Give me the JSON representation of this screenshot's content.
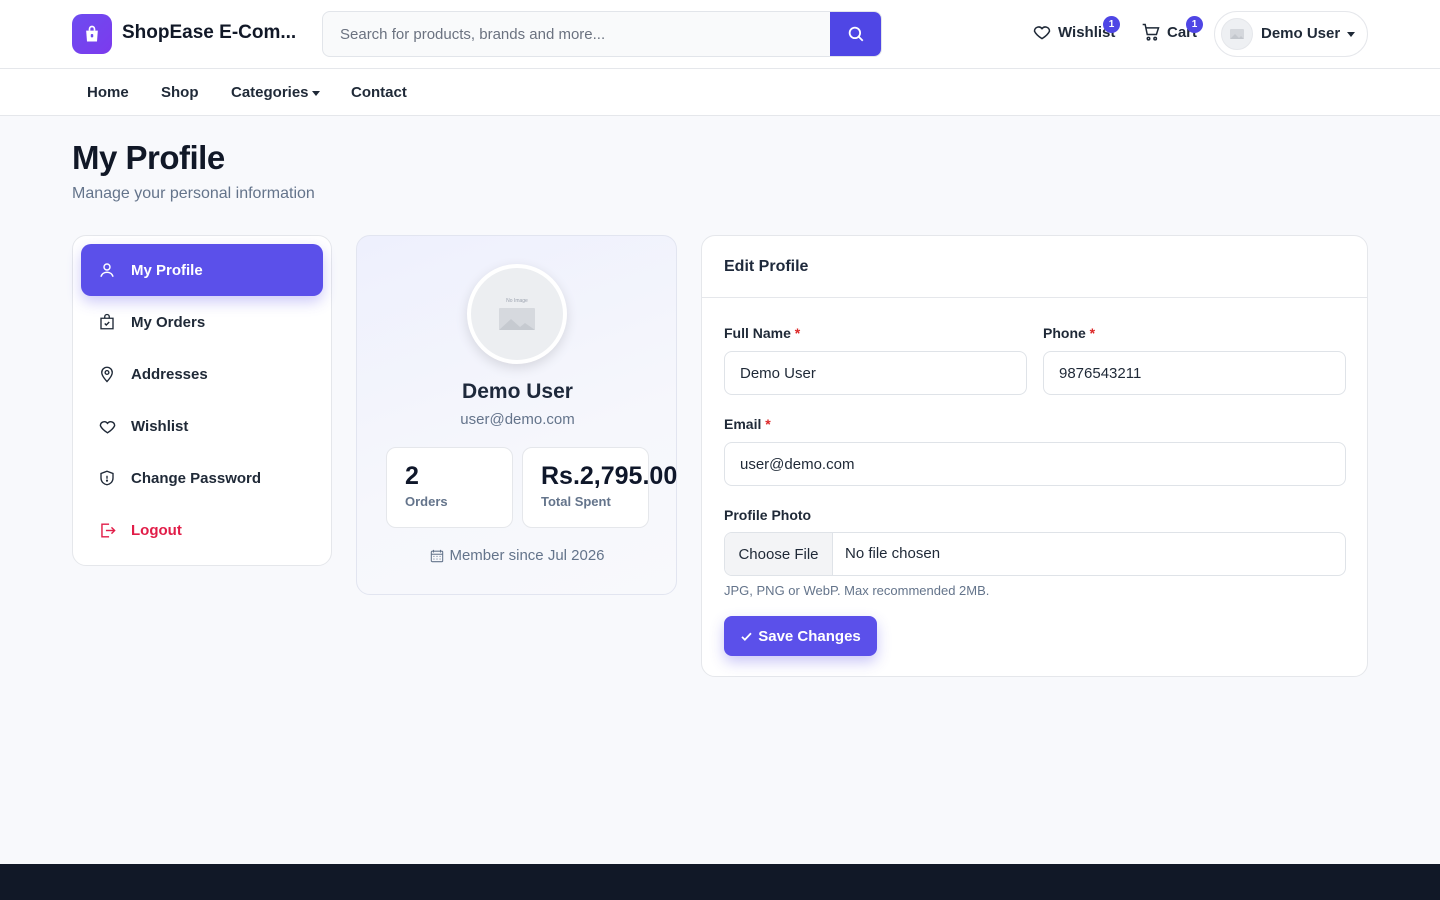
{
  "header": {
    "brand": "ShopEase E-Com...",
    "logo_icon": "shopping-bag-icon",
    "search_placeholder": "Search for products, brands and more...",
    "wishlist_label": "Wishlist",
    "wishlist_count": "1",
    "cart_label": "Cart",
    "cart_count": "1",
    "user_name": "Demo User"
  },
  "nav": {
    "items": [
      {
        "label": "Home"
      },
      {
        "label": "Shop"
      },
      {
        "label": "Categories"
      },
      {
        "label": "Contact"
      }
    ]
  },
  "page": {
    "title": "My Profile",
    "subtitle": "Manage your personal information"
  },
  "sidebar": {
    "items": [
      {
        "label": "My Profile",
        "icon": "user-icon"
      },
      {
        "label": "My Orders",
        "icon": "bag-check-icon"
      },
      {
        "label": "Addresses",
        "icon": "location-pin-icon"
      },
      {
        "label": "Wishlist",
        "icon": "heart-icon"
      },
      {
        "label": "Change Password",
        "icon": "shield-icon"
      },
      {
        "label": "Logout",
        "icon": "logout-icon"
      }
    ]
  },
  "profile": {
    "avatar_text": "No Image",
    "name": "Demo User",
    "email": "user@demo.com",
    "stats": [
      {
        "value": "2",
        "label": "Orders"
      },
      {
        "value": "Rs.2,795.00",
        "label": "Total Spent"
      }
    ],
    "member_since": "Member since Jul 2026"
  },
  "edit": {
    "title": "Edit Profile",
    "full_name_label": "Full Name",
    "full_name_value": "Demo User",
    "phone_label": "Phone",
    "phone_value": "9876543211",
    "email_label": "Email",
    "email_value": "user@demo.com",
    "required_mark": "*",
    "photo_label": "Profile Photo",
    "file_button": "Choose File",
    "file_status": "No file chosen",
    "hint": "JPG, PNG or WebP. Max recommended 2MB.",
    "save_label": "Save Changes"
  },
  "colors": {
    "accent": "#5b50ea",
    "logout": "#e11d48",
    "footer": "#111827"
  }
}
